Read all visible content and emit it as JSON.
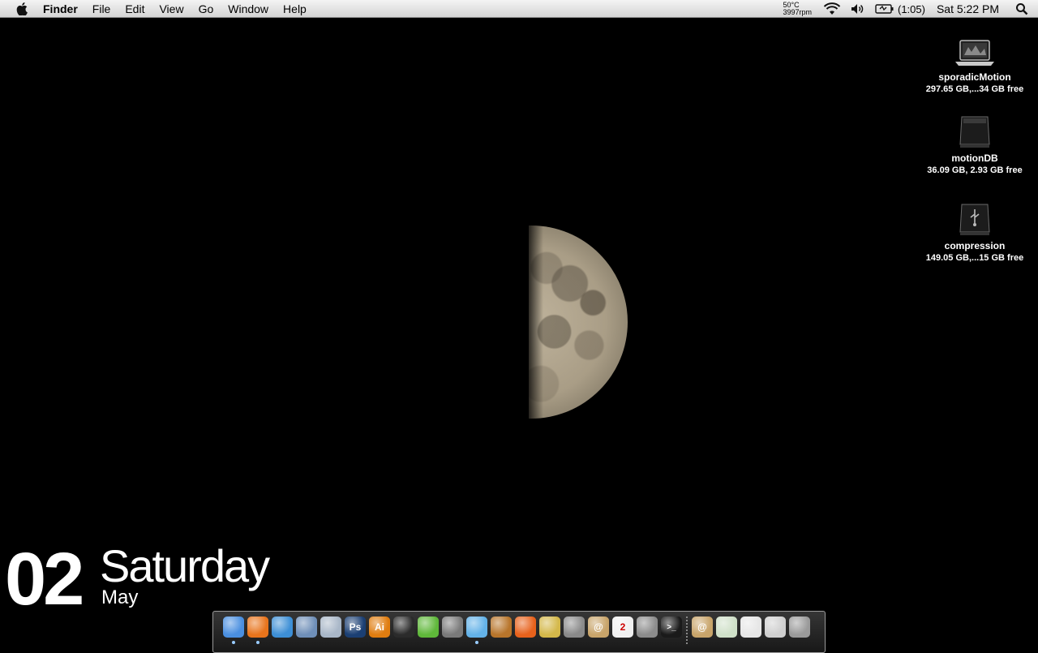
{
  "menubar": {
    "apple_icon": "apple-logo",
    "items": [
      "Finder",
      "File",
      "Edit",
      "View",
      "Go",
      "Window",
      "Help"
    ],
    "temperature": "50°C",
    "fan_speed": "3997rpm",
    "battery": "(1:05)",
    "clock": "Sat 5:22 PM"
  },
  "drives": [
    {
      "name": "sporadicMotion",
      "info": "297.65 GB,...34 GB free",
      "icon": "laptop-icon"
    },
    {
      "name": "motionDB",
      "info": "36.09 GB, 2.93 GB free",
      "icon": "hard-drive-icon"
    },
    {
      "name": "compression",
      "info": "149.05 GB,...15 GB free",
      "icon": "usb-drive-icon"
    }
  ],
  "date_widget": {
    "day": "02",
    "weekday": "Saturday",
    "month": "May"
  },
  "dock": {
    "apps": [
      {
        "name": "finder",
        "label": "",
        "color": "#4a8fe0",
        "running": true
      },
      {
        "name": "firefox",
        "label": "",
        "color": "#e8741c",
        "running": true
      },
      {
        "name": "safari",
        "label": "",
        "color": "#3d8fd6",
        "running": false
      },
      {
        "name": "mail",
        "label": "",
        "color": "#6f8fb8",
        "running": false
      },
      {
        "name": "ichat",
        "label": "",
        "color": "#a9b7c8",
        "running": false
      },
      {
        "name": "photoshop",
        "label": "Ps",
        "color": "#1b3f73",
        "running": false
      },
      {
        "name": "illustrator",
        "label": "Ai",
        "color": "#e07d10",
        "running": false
      },
      {
        "name": "aperture",
        "label": "",
        "color": "#2b2b2b",
        "running": false
      },
      {
        "name": "coda",
        "label": "",
        "color": "#5fb83a",
        "running": false
      },
      {
        "name": "transmit",
        "label": "",
        "color": "#7a7a7a",
        "running": false
      },
      {
        "name": "itunes",
        "label": "",
        "color": "#63b2e8",
        "running": true
      },
      {
        "name": "garageband",
        "label": "",
        "color": "#b8752b",
        "running": false
      },
      {
        "name": "app-orange",
        "label": "",
        "color": "#e8621c",
        "running": false
      },
      {
        "name": "imovie",
        "label": "",
        "color": "#d4b84a",
        "running": false
      },
      {
        "name": "app-grey",
        "label": "",
        "color": "#8a8a8a",
        "running": false
      },
      {
        "name": "address-book",
        "label": "@",
        "color": "#c8a46a",
        "running": false
      },
      {
        "name": "ical",
        "label": "2",
        "color": "#f0f0f0",
        "running": false
      },
      {
        "name": "system-preferences",
        "label": "",
        "color": "#8c8c8c",
        "running": false
      },
      {
        "name": "terminal",
        "label": ">_",
        "color": "#1a1a1a",
        "running": false
      }
    ],
    "stacks": [
      {
        "name": "address-stack",
        "label": "@",
        "color": "#c8a46a"
      },
      {
        "name": "documents-stack",
        "label": "",
        "color": "#cfe0c8"
      },
      {
        "name": "file-stack",
        "label": "",
        "color": "#e6e6e6"
      },
      {
        "name": "downloads-stack",
        "label": "",
        "color": "#cfcfcf"
      },
      {
        "name": "trash",
        "label": "",
        "color": "#9a9a9a"
      }
    ]
  }
}
